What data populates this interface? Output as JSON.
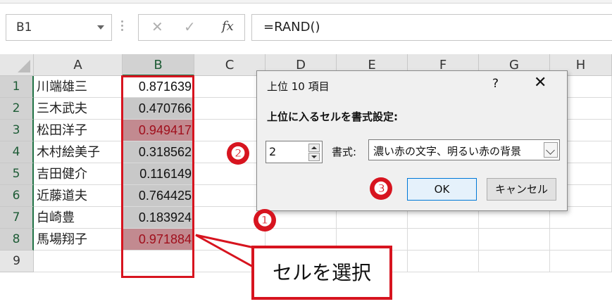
{
  "formula_bar": {
    "name_box": "B1",
    "cancel_glyph": "✕",
    "enter_glyph": "✓",
    "fx_label": "fx",
    "formula": "=RAND()"
  },
  "columns": [
    "A",
    "B",
    "C",
    "D",
    "E",
    "F",
    "G",
    "H"
  ],
  "rows": [
    {
      "num": "1",
      "name": "川端雄三",
      "value": "0.871639",
      "top": false
    },
    {
      "num": "2",
      "name": "三木武夫",
      "value": "0.470766",
      "top": false
    },
    {
      "num": "3",
      "name": "松田洋子",
      "value": "0.949417",
      "top": true
    },
    {
      "num": "4",
      "name": "木村絵美子",
      "value": "0.318562",
      "top": false
    },
    {
      "num": "5",
      "name": "吉田健介",
      "value": "0.116149",
      "top": false
    },
    {
      "num": "6",
      "name": "近藤道夫",
      "value": "0.764425",
      "top": false
    },
    {
      "num": "7",
      "name": "白崎豊",
      "value": "0.183924",
      "top": false
    },
    {
      "num": "8",
      "name": "馬場翔子",
      "value": "0.971884",
      "top": true
    },
    {
      "num": "9",
      "name": "",
      "value": "",
      "top": false
    }
  ],
  "dialog": {
    "title": "上位 10 項目",
    "help": "?",
    "close": "✕",
    "prompt": "上位に入るセルを書式設定:",
    "count_value": "2",
    "format_label": "書式:",
    "format_value": "濃い赤の文字、明るい赤の背景",
    "ok_label": "OK",
    "cancel_label": "キャンセル"
  },
  "annotations": {
    "step1": "❶",
    "step2": "❷",
    "step3": "❸",
    "callout_text": "セルを選択"
  },
  "colors": {
    "accent_red": "#d7141f",
    "excel_green": "#217346",
    "highlight_fill": "#c28a90",
    "highlight_text": "#a00f1c"
  }
}
